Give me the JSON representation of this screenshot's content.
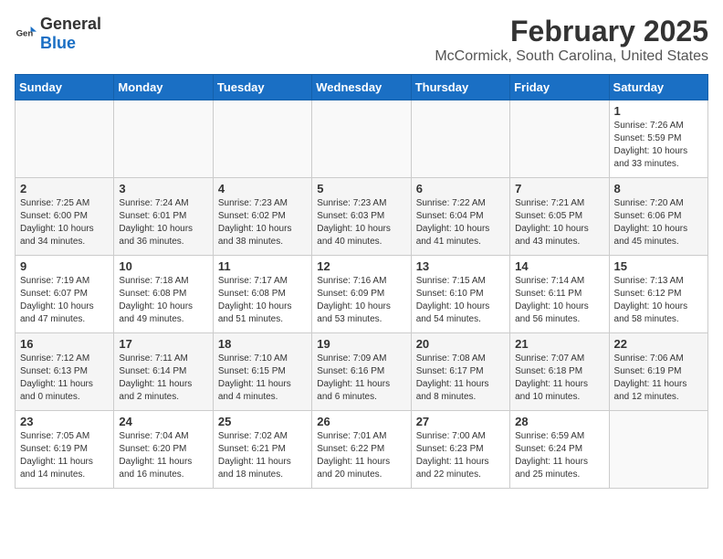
{
  "header": {
    "logo_general": "General",
    "logo_blue": "Blue",
    "month": "February 2025",
    "location": "McCormick, South Carolina, United States"
  },
  "weekdays": [
    "Sunday",
    "Monday",
    "Tuesday",
    "Wednesday",
    "Thursday",
    "Friday",
    "Saturday"
  ],
  "weeks": [
    [
      {
        "day": "",
        "info": ""
      },
      {
        "day": "",
        "info": ""
      },
      {
        "day": "",
        "info": ""
      },
      {
        "day": "",
        "info": ""
      },
      {
        "day": "",
        "info": ""
      },
      {
        "day": "",
        "info": ""
      },
      {
        "day": "1",
        "info": "Sunrise: 7:26 AM\nSunset: 5:59 PM\nDaylight: 10 hours\nand 33 minutes."
      }
    ],
    [
      {
        "day": "2",
        "info": "Sunrise: 7:25 AM\nSunset: 6:00 PM\nDaylight: 10 hours\nand 34 minutes."
      },
      {
        "day": "3",
        "info": "Sunrise: 7:24 AM\nSunset: 6:01 PM\nDaylight: 10 hours\nand 36 minutes."
      },
      {
        "day": "4",
        "info": "Sunrise: 7:23 AM\nSunset: 6:02 PM\nDaylight: 10 hours\nand 38 minutes."
      },
      {
        "day": "5",
        "info": "Sunrise: 7:23 AM\nSunset: 6:03 PM\nDaylight: 10 hours\nand 40 minutes."
      },
      {
        "day": "6",
        "info": "Sunrise: 7:22 AM\nSunset: 6:04 PM\nDaylight: 10 hours\nand 41 minutes."
      },
      {
        "day": "7",
        "info": "Sunrise: 7:21 AM\nSunset: 6:05 PM\nDaylight: 10 hours\nand 43 minutes."
      },
      {
        "day": "8",
        "info": "Sunrise: 7:20 AM\nSunset: 6:06 PM\nDaylight: 10 hours\nand 45 minutes."
      }
    ],
    [
      {
        "day": "9",
        "info": "Sunrise: 7:19 AM\nSunset: 6:07 PM\nDaylight: 10 hours\nand 47 minutes."
      },
      {
        "day": "10",
        "info": "Sunrise: 7:18 AM\nSunset: 6:08 PM\nDaylight: 10 hours\nand 49 minutes."
      },
      {
        "day": "11",
        "info": "Sunrise: 7:17 AM\nSunset: 6:08 PM\nDaylight: 10 hours\nand 51 minutes."
      },
      {
        "day": "12",
        "info": "Sunrise: 7:16 AM\nSunset: 6:09 PM\nDaylight: 10 hours\nand 53 minutes."
      },
      {
        "day": "13",
        "info": "Sunrise: 7:15 AM\nSunset: 6:10 PM\nDaylight: 10 hours\nand 54 minutes."
      },
      {
        "day": "14",
        "info": "Sunrise: 7:14 AM\nSunset: 6:11 PM\nDaylight: 10 hours\nand 56 minutes."
      },
      {
        "day": "15",
        "info": "Sunrise: 7:13 AM\nSunset: 6:12 PM\nDaylight: 10 hours\nand 58 minutes."
      }
    ],
    [
      {
        "day": "16",
        "info": "Sunrise: 7:12 AM\nSunset: 6:13 PM\nDaylight: 11 hours\nand 0 minutes."
      },
      {
        "day": "17",
        "info": "Sunrise: 7:11 AM\nSunset: 6:14 PM\nDaylight: 11 hours\nand 2 minutes."
      },
      {
        "day": "18",
        "info": "Sunrise: 7:10 AM\nSunset: 6:15 PM\nDaylight: 11 hours\nand 4 minutes."
      },
      {
        "day": "19",
        "info": "Sunrise: 7:09 AM\nSunset: 6:16 PM\nDaylight: 11 hours\nand 6 minutes."
      },
      {
        "day": "20",
        "info": "Sunrise: 7:08 AM\nSunset: 6:17 PM\nDaylight: 11 hours\nand 8 minutes."
      },
      {
        "day": "21",
        "info": "Sunrise: 7:07 AM\nSunset: 6:18 PM\nDaylight: 11 hours\nand 10 minutes."
      },
      {
        "day": "22",
        "info": "Sunrise: 7:06 AM\nSunset: 6:19 PM\nDaylight: 11 hours\nand 12 minutes."
      }
    ],
    [
      {
        "day": "23",
        "info": "Sunrise: 7:05 AM\nSunset: 6:19 PM\nDaylight: 11 hours\nand 14 minutes."
      },
      {
        "day": "24",
        "info": "Sunrise: 7:04 AM\nSunset: 6:20 PM\nDaylight: 11 hours\nand 16 minutes."
      },
      {
        "day": "25",
        "info": "Sunrise: 7:02 AM\nSunset: 6:21 PM\nDaylight: 11 hours\nand 18 minutes."
      },
      {
        "day": "26",
        "info": "Sunrise: 7:01 AM\nSunset: 6:22 PM\nDaylight: 11 hours\nand 20 minutes."
      },
      {
        "day": "27",
        "info": "Sunrise: 7:00 AM\nSunset: 6:23 PM\nDaylight: 11 hours\nand 22 minutes."
      },
      {
        "day": "28",
        "info": "Sunrise: 6:59 AM\nSunset: 6:24 PM\nDaylight: 11 hours\nand 25 minutes."
      },
      {
        "day": "",
        "info": ""
      }
    ]
  ]
}
